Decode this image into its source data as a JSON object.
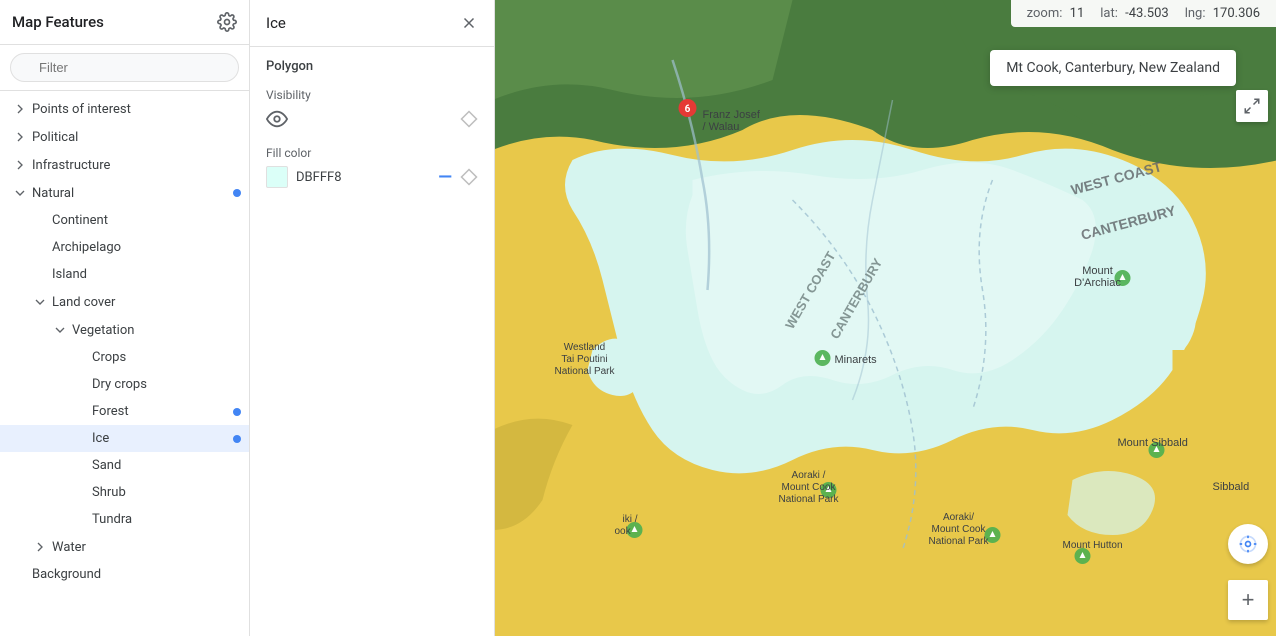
{
  "sidebar": {
    "title": "Map Features",
    "filter_placeholder": "Filter",
    "items": [
      {
        "id": "points-of-interest",
        "label": "Points of interest",
        "level": 0,
        "has_chevron": true,
        "chevron_dir": "right",
        "dot": false
      },
      {
        "id": "political",
        "label": "Political",
        "level": 0,
        "has_chevron": true,
        "chevron_dir": "right",
        "dot": false
      },
      {
        "id": "infrastructure",
        "label": "Infrastructure",
        "level": 0,
        "has_chevron": true,
        "chevron_dir": "right",
        "dot": false
      },
      {
        "id": "natural",
        "label": "Natural",
        "level": 0,
        "has_chevron": true,
        "chevron_dir": "down",
        "dot": true
      },
      {
        "id": "continent",
        "label": "Continent",
        "level": 1,
        "has_chevron": false,
        "dot": false
      },
      {
        "id": "archipelago",
        "label": "Archipelago",
        "level": 1,
        "has_chevron": false,
        "dot": false
      },
      {
        "id": "island",
        "label": "Island",
        "level": 1,
        "has_chevron": false,
        "dot": false
      },
      {
        "id": "land-cover",
        "label": "Land cover",
        "level": 1,
        "has_chevron": true,
        "chevron_dir": "down",
        "dot": false
      },
      {
        "id": "vegetation",
        "label": "Vegetation",
        "level": 2,
        "has_chevron": true,
        "chevron_dir": "down",
        "dot": false
      },
      {
        "id": "crops",
        "label": "Crops",
        "level": 3,
        "has_chevron": false,
        "dot": false
      },
      {
        "id": "dry-crops",
        "label": "Dry crops",
        "level": 3,
        "has_chevron": false,
        "dot": false
      },
      {
        "id": "forest",
        "label": "Forest",
        "level": 3,
        "has_chevron": false,
        "dot": true
      },
      {
        "id": "ice",
        "label": "Ice",
        "level": 3,
        "has_chevron": false,
        "dot": true,
        "selected": true
      },
      {
        "id": "sand",
        "label": "Sand",
        "level": 3,
        "has_chevron": false,
        "dot": false
      },
      {
        "id": "shrub",
        "label": "Shrub",
        "level": 3,
        "has_chevron": false,
        "dot": false
      },
      {
        "id": "tundra",
        "label": "Tundra",
        "level": 3,
        "has_chevron": false,
        "dot": false
      },
      {
        "id": "water",
        "label": "Water",
        "level": 1,
        "has_chevron": true,
        "chevron_dir": "right",
        "dot": false
      },
      {
        "id": "background",
        "label": "Background",
        "level": 0,
        "has_chevron": false,
        "dot": false
      }
    ]
  },
  "detail": {
    "title": "Ice",
    "polygon_label": "Polygon",
    "visibility_label": "Visibility",
    "fill_color_label": "Fill color",
    "color_hex": "DBFFF8",
    "color_value": "#DBFFF8"
  },
  "map": {
    "zoom_label": "zoom:",
    "zoom_value": "11",
    "lat_label": "lat:",
    "lat_value": "-43.503",
    "lng_label": "lng:",
    "lng_value": "170.306",
    "tooltip": "Mt Cook, Canterbury, New Zealand"
  },
  "icons": {
    "chevron_right": "›",
    "chevron_down": "⌄",
    "close": "✕",
    "gear": "⚙",
    "filter": "≡",
    "eye": "👁",
    "diamond": "◇",
    "fullscreen": "⛶",
    "location": "⊕",
    "plus": "+"
  }
}
